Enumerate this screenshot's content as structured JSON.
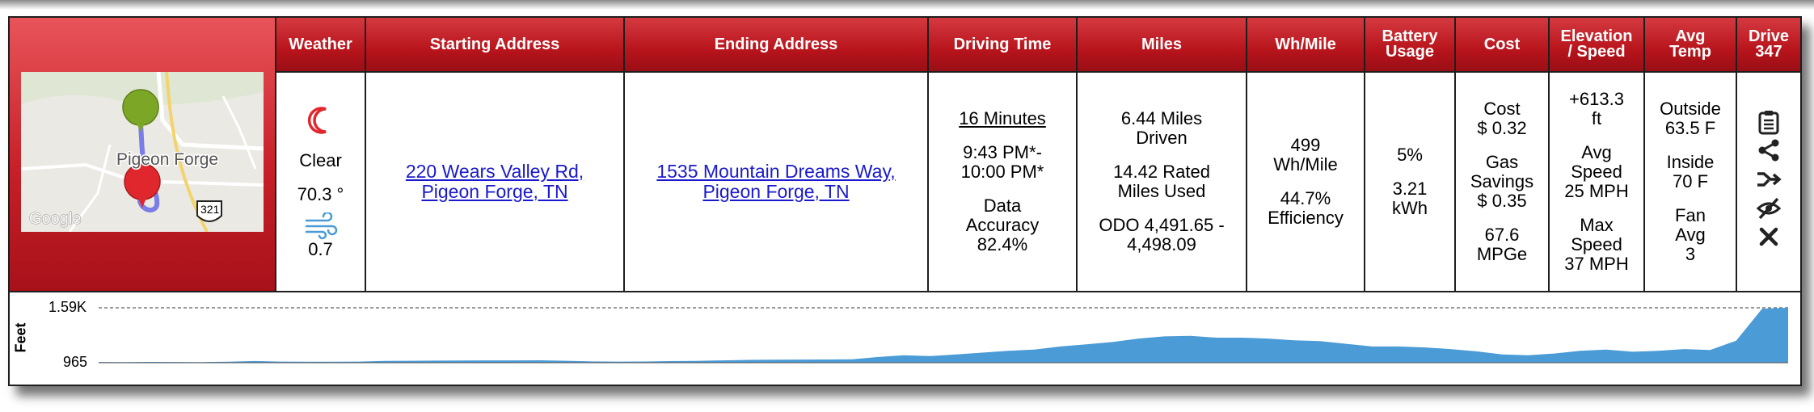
{
  "headers": {
    "weather": "Weather",
    "starting_address": "Starting Address",
    "ending_address": "Ending Address",
    "driving_time": "Driving Time",
    "miles": "Miles",
    "wh_mile": "Wh/Mile",
    "battery_usage_l1": "Battery",
    "battery_usage_l2": "Usage",
    "cost": "Cost",
    "elevation_speed_l1": "Elevation",
    "elevation_speed_l2": "/ Speed",
    "avg_temp_l1": "Avg",
    "avg_temp_l2": "Temp",
    "drive_l1": "Drive",
    "drive_l2": "347"
  },
  "map": {
    "place_label": "Pigeon Forge",
    "route_shield": "321",
    "provider": "Google",
    "start_pin_color": "#7ca726",
    "end_pin_color": "#e0272d",
    "route_color": "#7a7ce8"
  },
  "weather": {
    "icon": "crescent-moon-icon",
    "condition": "Clear",
    "temperature": "70.3 °",
    "wind_icon": "wind-icon",
    "wind": "0.7"
  },
  "start": {
    "line1": "220 Wears Valley Rd,",
    "line2": "Pigeon Forge, TN"
  },
  "end": {
    "line1": "1535 Mountain Dreams Way,",
    "line2": "Pigeon Forge, TN"
  },
  "driving_time": {
    "duration": "16 Minutes",
    "time_l1": "9:43 PM*-",
    "time_l2": "10:00 PM*",
    "accuracy_l1": "Data",
    "accuracy_l2": "Accuracy",
    "accuracy_l3": "82.4%"
  },
  "miles": {
    "driven_l1": "6.44 Miles",
    "driven_l2": "Driven",
    "rated_l1": "14.42 Rated",
    "rated_l2": "Miles Used",
    "odo_l1": "ODO 4,491.65 -",
    "odo_l2": "4,498.09"
  },
  "wh_mile": {
    "value_l1": "499",
    "value_l2": "Wh/Mile",
    "eff_l1": "44.7%",
    "eff_l2": "Efficiency"
  },
  "battery": {
    "percent": "5%",
    "kwh_l1": "3.21",
    "kwh_l2": "kWh"
  },
  "cost": {
    "cost_l1": "Cost",
    "cost_l2": "$ 0.32",
    "gas_l1": "Gas",
    "gas_l2": "Savings",
    "gas_l3": "$ 0.35",
    "mpge_l1": "67.6",
    "mpge_l2": "MPGe"
  },
  "elevation": {
    "delta_l1": "+613.3",
    "delta_l2": "ft",
    "avg_l1": "Avg",
    "avg_l2": "Speed",
    "avg_l3": "25 MPH",
    "max_l1": "Max",
    "max_l2": "Speed",
    "max_l3": "37 MPH"
  },
  "temp": {
    "outside_l1": "Outside",
    "outside_l2": "63.5 F",
    "inside_l1": "Inside",
    "inside_l2": "70 F",
    "fan_l1": "Fan",
    "fan_l2": "Avg",
    "fan_l3": "3"
  },
  "actions": [
    {
      "name": "notes-icon",
      "glyph": "📋"
    },
    {
      "name": "share-icon",
      "glyph": "⋖"
    },
    {
      "name": "merge-icon",
      "glyph": "⤳"
    },
    {
      "name": "hide-icon",
      "glyph": "⊘"
    },
    {
      "name": "delete-icon",
      "glyph": "✕"
    }
  ],
  "chart_data": {
    "type": "area",
    "ylabel": "Feet",
    "ytick_labels": [
      "1.59K",
      "965"
    ],
    "ylim": [
      965,
      1590
    ],
    "color": "#4a9bd6",
    "values": [
      973,
      972,
      974,
      973,
      972,
      976,
      984,
      978,
      976,
      977,
      978,
      985,
      987,
      989,
      991,
      992,
      992,
      993,
      987,
      980,
      978,
      979,
      983,
      985,
      992,
      997,
      1000,
      1001,
      1002,
      1004,
      1030,
      1050,
      1040,
      1060,
      1080,
      1100,
      1115,
      1150,
      1175,
      1200,
      1240,
      1265,
      1270,
      1250,
      1250,
      1240,
      1220,
      1210,
      1180,
      1150,
      1150,
      1140,
      1120,
      1095,
      1060,
      1050,
      1070,
      1100,
      1115,
      1090,
      1100,
      1120,
      1110,
      1215,
      1580,
      1590
    ]
  }
}
